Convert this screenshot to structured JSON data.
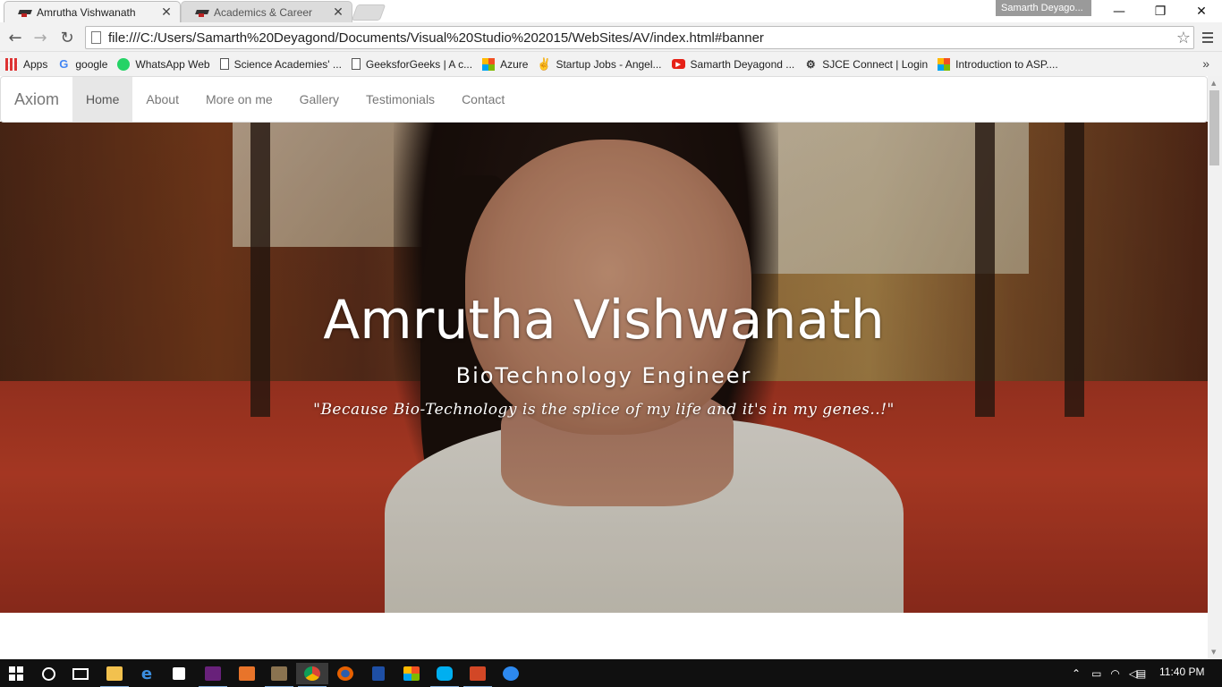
{
  "browser": {
    "tabs": [
      {
        "title": "Amrutha Vishwanath",
        "close": "✕"
      },
      {
        "title": "Academics & Career",
        "close": "✕"
      }
    ],
    "profile_name": "Samarth Deyago...",
    "window_controls": {
      "minimize": "—",
      "maximize": "❐",
      "close": "✕"
    },
    "url": "file:///C:/Users/Samarth%20Deyagond/Documents/Visual%20Studio%202015/WebSites/AV/index.html#banner",
    "bookmarks": [
      {
        "label": "Apps",
        "icon": "apps-icon"
      },
      {
        "label": "google",
        "icon": "google-icon"
      },
      {
        "label": "WhatsApp Web",
        "icon": "whatsapp-icon"
      },
      {
        "label": "Science Academies' ...",
        "icon": "page-icon"
      },
      {
        "label": "GeeksforGeeks | A c...",
        "icon": "page-icon"
      },
      {
        "label": "Azure",
        "icon": "microsoft-icon"
      },
      {
        "label": "Startup Jobs - Angel...",
        "icon": "angellist-icon"
      },
      {
        "label": "Samarth Deyagond ...",
        "icon": "youtube-icon"
      },
      {
        "label": "SJCE Connect | Login",
        "icon": "sjce-icon"
      },
      {
        "label": "Introduction to ASP....",
        "icon": "microsoft-icon"
      }
    ],
    "bookmarks_more": "»"
  },
  "site": {
    "brand": "Axiom",
    "nav": [
      {
        "label": "Home",
        "active": true
      },
      {
        "label": "About",
        "active": false
      },
      {
        "label": "More on me",
        "active": false
      },
      {
        "label": "Gallery",
        "active": false
      },
      {
        "label": "Testimonials",
        "active": false
      },
      {
        "label": "Contact",
        "active": false
      }
    ],
    "hero": {
      "name": "Amrutha Vishwanath",
      "role": "BioTechnology Engineer",
      "quote": "\"Because Bio-Technology is the splice of my life and it's in my genes..!\""
    }
  },
  "taskbar": {
    "clock": "11:40 PM",
    "apps": [
      "start-icon",
      "search-icon",
      "task-view-icon",
      "file-explorer-icon",
      "edge-icon",
      "store-icon",
      "visual-studio-icon",
      "app-icon",
      "app-icon",
      "chrome-icon",
      "firefox-icon",
      "app-icon",
      "app-icon",
      "skype-icon",
      "app-icon",
      "app-icon"
    ]
  },
  "colors": {
    "nav_active_bg": "#e7e7e7",
    "nav_text": "#777777",
    "taskbar_bg": "#101010"
  }
}
